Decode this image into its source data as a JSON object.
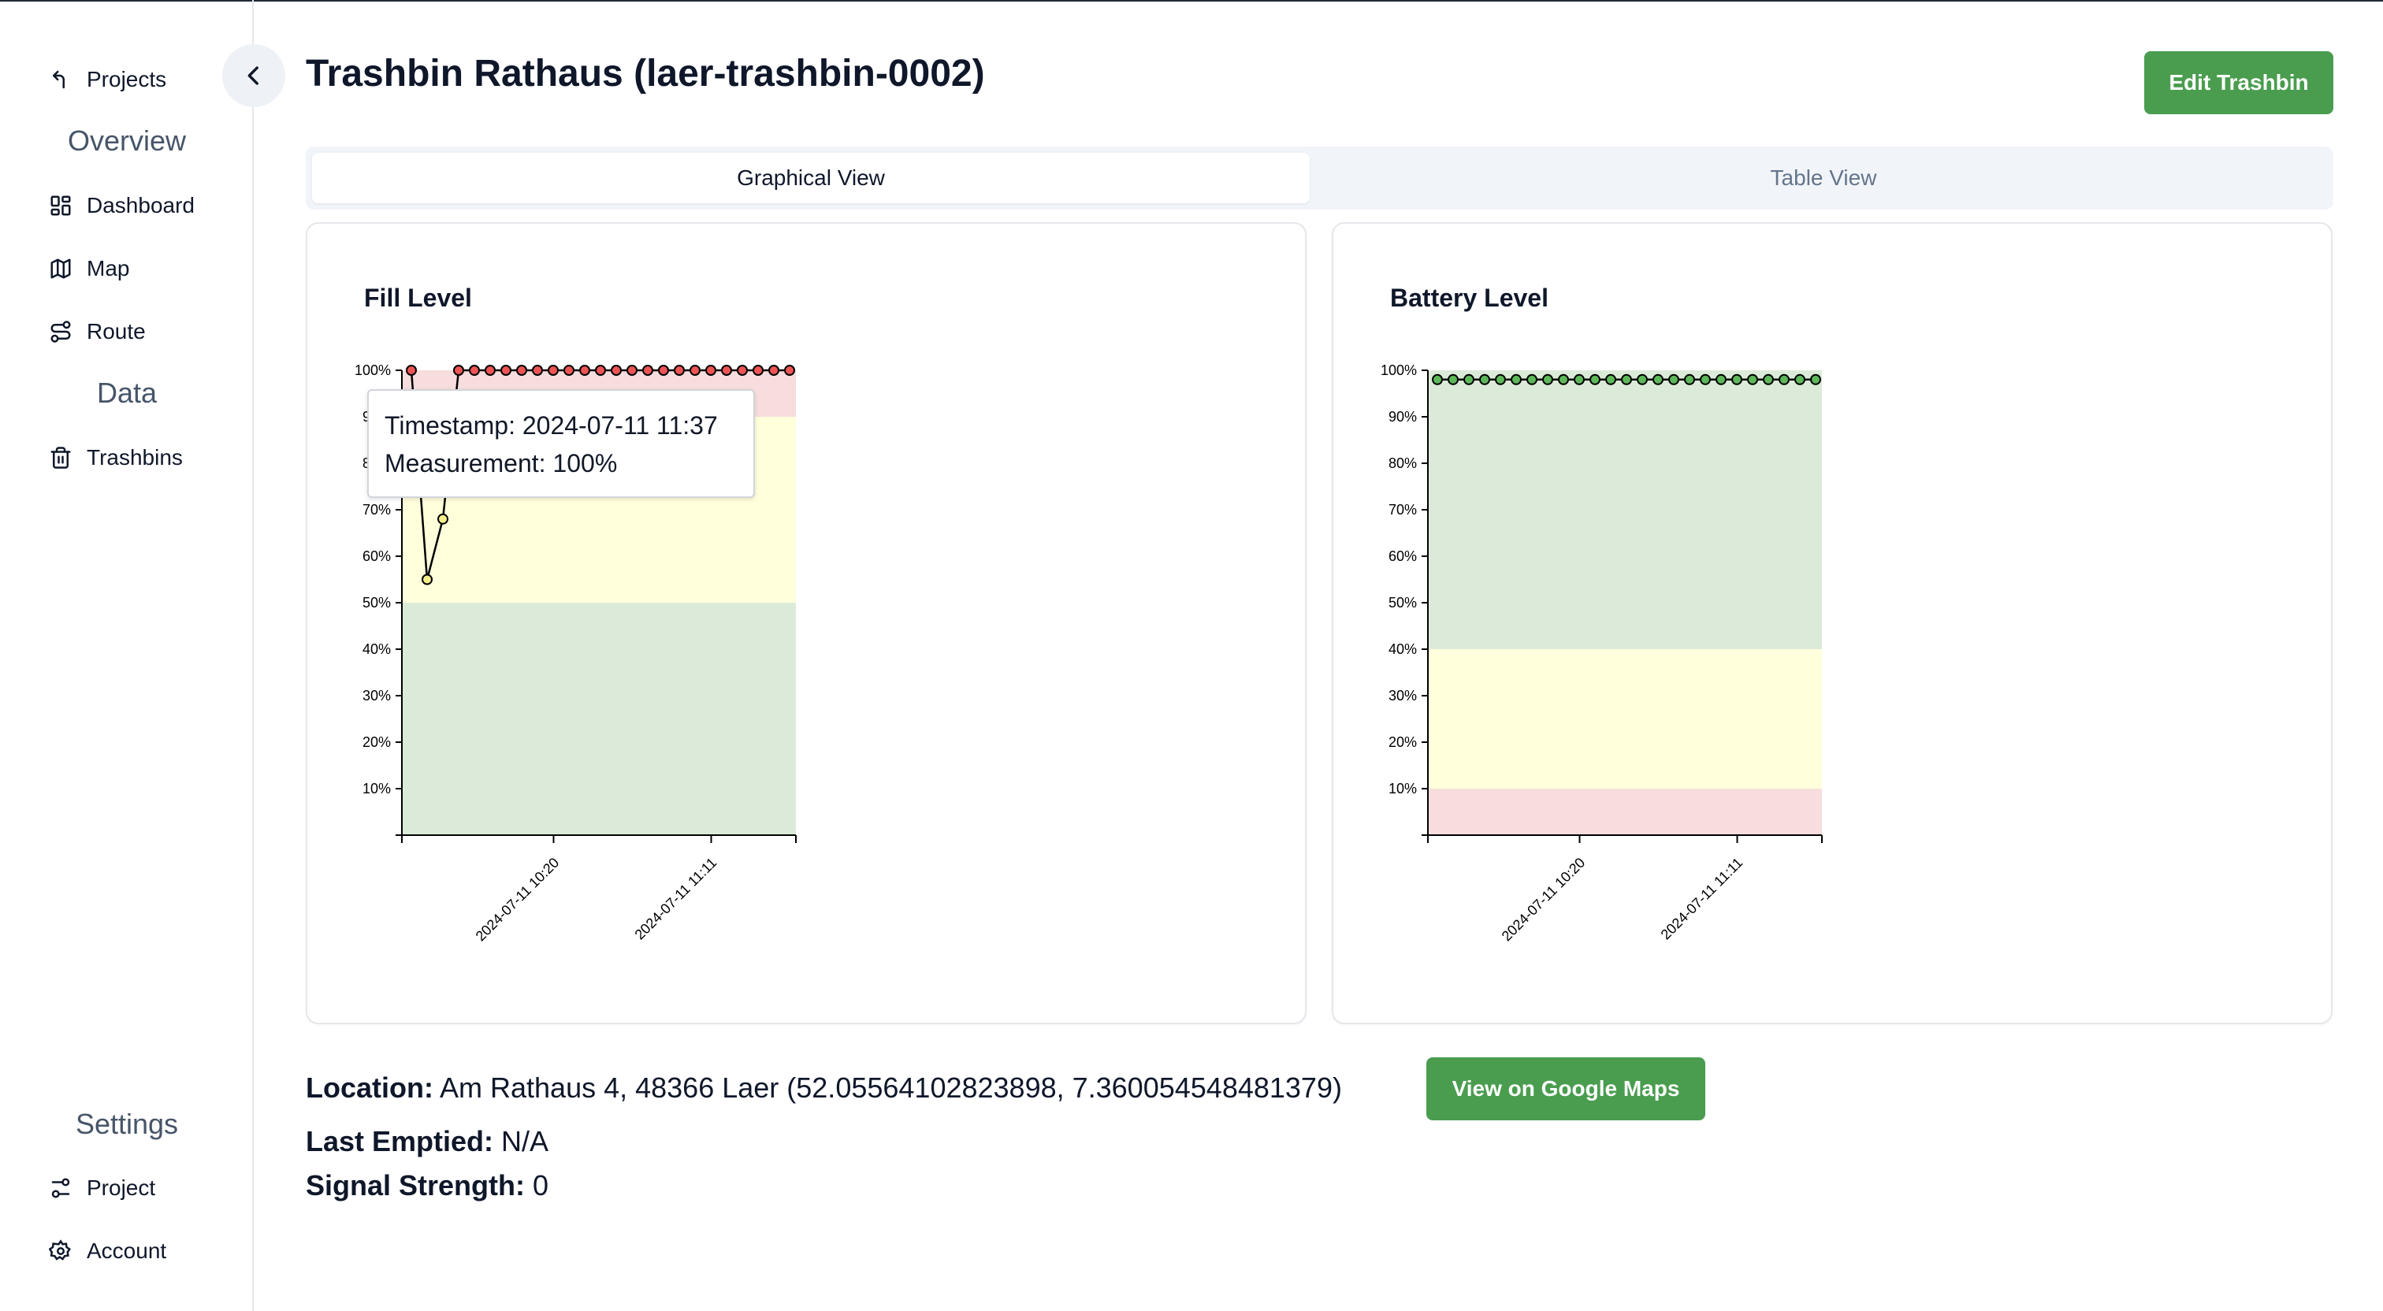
{
  "sidebar": {
    "projects_label": "Projects",
    "overview_title": "Overview",
    "data_title": "Data",
    "settings_title": "Settings",
    "items": {
      "dashboard": "Dashboard",
      "map": "Map",
      "route": "Route",
      "trashbins": "Trashbins",
      "project": "Project",
      "account": "Account"
    }
  },
  "header": {
    "title": "Trashbin Rathaus (laer-trashbin-0002)",
    "edit_button": "Edit Trashbin"
  },
  "tabs": {
    "graphical": "Graphical View",
    "table": "Table View",
    "active": "graphical"
  },
  "charts": {
    "fill": {
      "title": "Fill Level",
      "tooltip_timestamp": "Timestamp: 2024-07-11 11:37",
      "tooltip_measurement": "Measurement: 100%"
    },
    "battery": {
      "title": "Battery Level"
    }
  },
  "info": {
    "location_label": "Location:",
    "location_value": "Am Rathaus 4, 48366 Laer (52.05564102823898, 7.360054548481379)",
    "maps_button": "View on Google Maps",
    "last_emptied_label": "Last Emptied:",
    "last_emptied_value": "N/A",
    "signal_label": "Signal Strength:",
    "signal_value": "0"
  },
  "chart_data": [
    {
      "type": "line",
      "title": "Fill Level",
      "ylim": [
        0,
        100
      ],
      "yticks": [
        "10%",
        "20%",
        "30%",
        "40%",
        "50%",
        "60%",
        "70%",
        "80%",
        "90%",
        "100%"
      ],
      "xticks": [
        "2024-07-11 10:20",
        "2024-07-11 11:11"
      ],
      "bands": [
        {
          "from": 0,
          "to": 50,
          "color": "#dcebd9"
        },
        {
          "from": 50,
          "to": 90,
          "color": "#ffffdc"
        },
        {
          "from": 90,
          "to": 100,
          "color": "#f7dddd"
        }
      ],
      "series": [
        {
          "values": [
            100,
            55,
            68,
            100,
            100,
            100,
            100,
            100,
            100,
            100,
            100,
            100,
            100,
            100,
            100,
            100,
            100,
            100,
            100,
            100,
            100,
            100,
            100,
            100,
            100
          ]
        }
      ],
      "point_colors": {
        "red": "#ee5454",
        "yellow": "#f5ef8a",
        "green": "#5db85a"
      },
      "tooltip": {
        "timestamp": "2024-07-11 11:37",
        "measurement": "100%"
      }
    },
    {
      "type": "line",
      "title": "Battery Level",
      "ylim": [
        0,
        100
      ],
      "yticks": [
        "10%",
        "20%",
        "30%",
        "40%",
        "50%",
        "60%",
        "70%",
        "80%",
        "90%",
        "100%"
      ],
      "xticks": [
        "2024-07-11 10:20",
        "2024-07-11 11:11"
      ],
      "bands": [
        {
          "from": 0,
          "to": 10,
          "color": "#f7dddd"
        },
        {
          "from": 10,
          "to": 40,
          "color": "#ffffdc"
        },
        {
          "from": 40,
          "to": 100,
          "color": "#dcebd9"
        }
      ],
      "series": [
        {
          "values": [
            98,
            98,
            98,
            98,
            98,
            98,
            98,
            98,
            98,
            98,
            98,
            98,
            98,
            98,
            98,
            98,
            98,
            98,
            98,
            98,
            98,
            98,
            98,
            98,
            98
          ]
        }
      ],
      "point_colors": {
        "red": "#ee5454",
        "yellow": "#f5ef8a",
        "green": "#5db85a"
      }
    }
  ]
}
